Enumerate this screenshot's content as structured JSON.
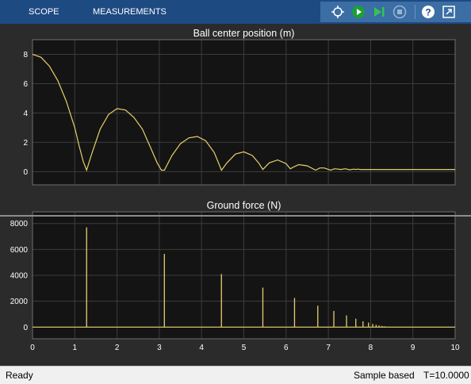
{
  "toolstrip": {
    "tabs": [
      "SCOPE",
      "MEASUREMENTS"
    ],
    "tool_icons": [
      "highlight-blocks-icon",
      "run-icon",
      "step-forward-icon",
      "stop-icon",
      "help-icon",
      "undock-icon"
    ]
  },
  "status": {
    "state": "Ready",
    "mode": "Sample based",
    "time": "T=10.0000"
  },
  "colors": {
    "background": "#2b2b2b",
    "axes_background": "#141414",
    "grid": "#3c3c3c",
    "trace": "#e6cf6b",
    "toolstrip": "#1e4a82"
  },
  "chart_data": [
    {
      "type": "line",
      "title": "Ball center position (m)",
      "xlabel": "",
      "ylabel": "",
      "xlim": [
        0,
        10
      ],
      "ylim": [
        -0.9,
        9
      ],
      "xticks": [
        0,
        1,
        2,
        3,
        4,
        5,
        6,
        7,
        8,
        9,
        10
      ],
      "yticks": [
        0,
        2,
        4,
        6,
        8
      ],
      "show_xtick_labels": false,
      "grid": true,
      "series": [
        {
          "x": [
            0,
            0.2,
            0.4,
            0.6,
            0.8,
            1.0,
            1.1,
            1.2,
            1.28,
            1.4,
            1.6,
            1.8,
            2.0,
            2.2,
            2.4,
            2.6,
            2.8,
            2.95,
            3.05,
            3.12,
            3.3,
            3.5,
            3.7,
            3.9,
            4.1,
            4.3,
            4.47,
            4.6,
            4.8,
            5.0,
            5.2,
            5.35,
            5.45,
            5.6,
            5.8,
            6.0,
            6.1,
            6.2,
            6.3,
            6.5,
            6.7,
            6.8,
            6.9,
            7.05,
            7.15,
            7.3,
            7.4,
            7.5,
            7.6,
            7.65,
            7.7,
            7.75,
            7.8,
            8.0,
            10.0
          ],
          "y": [
            8.0,
            7.8,
            7.2,
            6.2,
            4.8,
            3.0,
            1.8,
            0.7,
            0.1,
            1.2,
            2.9,
            3.9,
            4.3,
            4.2,
            3.7,
            2.9,
            1.6,
            0.6,
            0.1,
            0.1,
            1.1,
            1.9,
            2.3,
            2.4,
            2.1,
            1.3,
            0.1,
            0.6,
            1.2,
            1.35,
            1.1,
            0.6,
            0.15,
            0.6,
            0.8,
            0.55,
            0.2,
            0.35,
            0.48,
            0.4,
            0.1,
            0.25,
            0.25,
            0.1,
            0.2,
            0.15,
            0.2,
            0.13,
            0.17,
            0.15,
            0.17,
            0.15,
            0.15,
            0.15,
            0.15
          ]
        }
      ]
    },
    {
      "type": "line",
      "title": "Ground force (N)",
      "xlabel": "",
      "ylabel": "",
      "xlim": [
        0,
        10
      ],
      "ylim": [
        -900,
        8900
      ],
      "xticks": [
        0,
        1,
        2,
        3,
        4,
        5,
        6,
        7,
        8,
        9,
        10
      ],
      "yticks": [
        0,
        2000,
        4000,
        6000,
        8000
      ],
      "show_xtick_labels": true,
      "grid": true,
      "spikes": [
        {
          "t": 1.28,
          "value": 7700
        },
        {
          "t": 3.12,
          "value": 5650
        },
        {
          "t": 4.47,
          "value": 4100
        },
        {
          "t": 5.45,
          "value": 3050
        },
        {
          "t": 6.2,
          "value": 2250
        },
        {
          "t": 6.75,
          "value": 1650
        },
        {
          "t": 7.13,
          "value": 1250
        },
        {
          "t": 7.43,
          "value": 900
        },
        {
          "t": 7.65,
          "value": 650
        },
        {
          "t": 7.82,
          "value": 450
        },
        {
          "t": 7.95,
          "value": 350
        },
        {
          "t": 8.05,
          "value": 250
        },
        {
          "t": 8.13,
          "value": 180
        },
        {
          "t": 8.2,
          "value": 130
        },
        {
          "t": 8.27,
          "value": 90
        },
        {
          "t": 8.33,
          "value": 60
        }
      ]
    }
  ]
}
